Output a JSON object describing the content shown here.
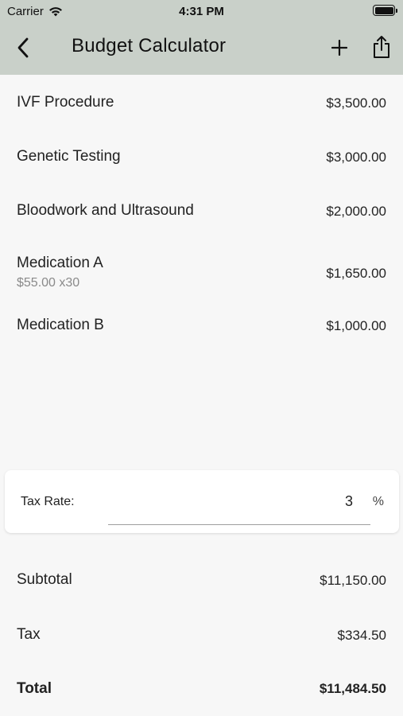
{
  "status_bar": {
    "carrier": "Carrier",
    "time": "4:31 PM"
  },
  "nav": {
    "title": "Budget Calculator"
  },
  "items": [
    {
      "name": "IVF Procedure",
      "price": "$3,500.00"
    },
    {
      "name": "Genetic Testing",
      "price": "$3,000.00"
    },
    {
      "name": "Bloodwork and Ultrasound",
      "price": "$2,000.00"
    },
    {
      "name": "Medication A",
      "detail": "$55.00 x30",
      "price": "$1,650.00"
    },
    {
      "name": "Medication B",
      "price": "$1,000.00"
    }
  ],
  "tax": {
    "label": "Tax Rate:",
    "value": "3",
    "suffix": "%"
  },
  "summary": {
    "subtotal_label": "Subtotal",
    "subtotal_value": "$11,150.00",
    "tax_label": "Tax",
    "tax_value": "$334.50",
    "total_label": "Total",
    "total_value": "$11,484.50"
  },
  "colors": {
    "header_bg": "#c9d0c9",
    "page_bg": "#f7f7f7"
  },
  "icons": [
    "wifi-icon",
    "battery-icon",
    "back-chevron-icon",
    "plus-icon",
    "share-icon"
  ]
}
